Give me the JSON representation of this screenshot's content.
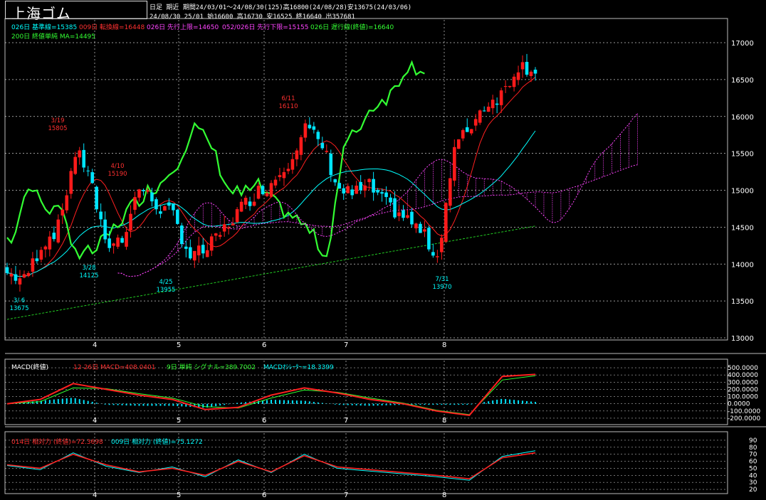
{
  "header": {
    "symbol": "上海ゴム",
    "line1": "日足 期近 期間24/03/01～24/08/30(125)高16800(24/08/28)安13675(24/03/06)",
    "line2": "24/08/30 25/01 始16600 高16730 安16525 終16640 出357681"
  },
  "legend_main": [
    {
      "text": "026日 基準線=15385",
      "color": "#00ffff"
    },
    {
      "text": "009日 転換線=16448",
      "color": "#ff3030"
    },
    {
      "text": "026日 先行上限=14650",
      "color": "#ff44ff"
    },
    {
      "text": "052/026日 先行下限=15155",
      "color": "#ff44ff"
    },
    {
      "text": "026日 遅行線(終値)=16640",
      "color": "#33ff33"
    },
    {
      "text": "200日 終値単純 MA=14495",
      "color": "#33ff33"
    }
  ],
  "legend_macd": [
    {
      "text": "MACD(終値)",
      "color": "#ffffff"
    },
    {
      "text": "12-26日 MACD=408.0401",
      "color": "#ff3030"
    },
    {
      "text": "9日 単純 シグナル=389.7002",
      "color": "#33ff33"
    },
    {
      "text": "MACDｵｼﾚｰﾀｰ=18.3399",
      "color": "#00ffff"
    }
  ],
  "legend_rsi": [
    {
      "text": "014日 相対力 (終値)=72.3698",
      "color": "#ff3030"
    },
    {
      "text": "009日 相対力 (終値)=75.1272",
      "color": "#00ffff"
    }
  ],
  "month_labels": [
    "4",
    "5",
    "6",
    "7",
    "8"
  ],
  "colors": {
    "up": "#ff1a1a",
    "down": "#00e5ff",
    "grid": "#ffffff",
    "tenkan": "#ff2020",
    "kijun": "#00ffff",
    "chikou": "#33ff33",
    "ma200": "#22cc22",
    "kumo": "#ff44ff"
  },
  "chart_data": [
    {
      "type": "candlestick",
      "title": "上海ゴム",
      "y_ticks": [
        13000,
        13500,
        14000,
        14500,
        15000,
        15500,
        16000,
        16500,
        17000
      ],
      "ylim": [
        13000,
        17000
      ],
      "x_month_ticks": [
        "4",
        "5",
        "6",
        "7",
        "8"
      ],
      "annotations": [
        {
          "date": "3/6",
          "label": "3/ 6",
          "value": "13675"
        },
        {
          "date": "3/19",
          "label": "3/19",
          "value": "15805"
        },
        {
          "date": "3/28",
          "label": "3/28",
          "value": "14125"
        },
        {
          "date": "4/10",
          "label": "4/10",
          "value": "15190"
        },
        {
          "date": "4/25",
          "label": "4/25",
          "value": "13955"
        },
        {
          "date": "6/11",
          "label": "6/11",
          "value": "16110"
        },
        {
          "date": "7/31",
          "label": "7/31",
          "value": "13970"
        }
      ],
      "close_series": [
        {
          "date": "3/1",
          "close": 13880
        },
        {
          "date": "3/6",
          "close": 13780
        },
        {
          "date": "3/12",
          "close": 14250
        },
        {
          "date": "3/15",
          "close": 14500
        },
        {
          "date": "3/19",
          "close": 15500
        },
        {
          "date": "3/22",
          "close": 15300
        },
        {
          "date": "3/28",
          "close": 14250
        },
        {
          "date": "4/1",
          "close": 14350
        },
        {
          "date": "4/10",
          "close": 15050
        },
        {
          "date": "4/15",
          "close": 14800
        },
        {
          "date": "4/18",
          "close": 14650
        },
        {
          "date": "4/25",
          "close": 14100
        },
        {
          "date": "5/1",
          "close": 14200
        },
        {
          "date": "5/10",
          "close": 14400
        },
        {
          "date": "5/17",
          "close": 14700
        },
        {
          "date": "5/24",
          "close": 14950
        },
        {
          "date": "5/31",
          "close": 15100
        },
        {
          "date": "6/6",
          "close": 15400
        },
        {
          "date": "6/11",
          "close": 15850
        },
        {
          "date": "6/14",
          "close": 15600
        },
        {
          "date": "6/21",
          "close": 15000
        },
        {
          "date": "6/28",
          "close": 14950
        },
        {
          "date": "7/5",
          "close": 15050
        },
        {
          "date": "7/12",
          "close": 14800
        },
        {
          "date": "7/19",
          "close": 14650
        },
        {
          "date": "7/26",
          "close": 14450
        },
        {
          "date": "7/31",
          "close": 14100
        },
        {
          "date": "8/2",
          "close": 15550
        },
        {
          "date": "8/9",
          "close": 15900
        },
        {
          "date": "8/16",
          "close": 16150
        },
        {
          "date": "8/23",
          "close": 16300
        },
        {
          "date": "8/28",
          "close": 16700
        },
        {
          "date": "8/30",
          "close": 16640
        }
      ]
    },
    {
      "type": "line",
      "title": "MACD(終値)",
      "y_ticks": [
        500,
        400,
        300,
        200,
        100,
        0,
        -100,
        -200
      ],
      "ylim": [
        -220,
        520
      ],
      "series": [
        {
          "name": "MACD",
          "values": [
            0,
            60,
            280,
            200,
            120,
            60,
            -80,
            -50,
            120,
            220,
            150,
            60,
            0,
            -100,
            -160,
            380,
            408
          ]
        },
        {
          "name": "シグナル",
          "values": [
            0,
            30,
            220,
            210,
            140,
            80,
            -40,
            -60,
            80,
            190,
            160,
            80,
            10,
            -90,
            -150,
            330,
            390
          ]
        }
      ]
    },
    {
      "type": "line",
      "title": "相対力",
      "y_ticks": [
        90,
        80,
        70,
        60,
        50,
        40,
        30,
        20
      ],
      "ylim": [
        18,
        92
      ],
      "series": [
        {
          "name": "014日 相対力",
          "values": [
            55,
            50,
            70,
            55,
            45,
            50,
            40,
            60,
            45,
            68,
            52,
            48,
            44,
            40,
            35,
            65,
            72
          ]
        },
        {
          "name": "009日 相対力",
          "values": [
            54,
            48,
            72,
            53,
            44,
            52,
            38,
            62,
            44,
            70,
            50,
            46,
            42,
            38,
            33,
            67,
            75
          ]
        }
      ]
    }
  ]
}
